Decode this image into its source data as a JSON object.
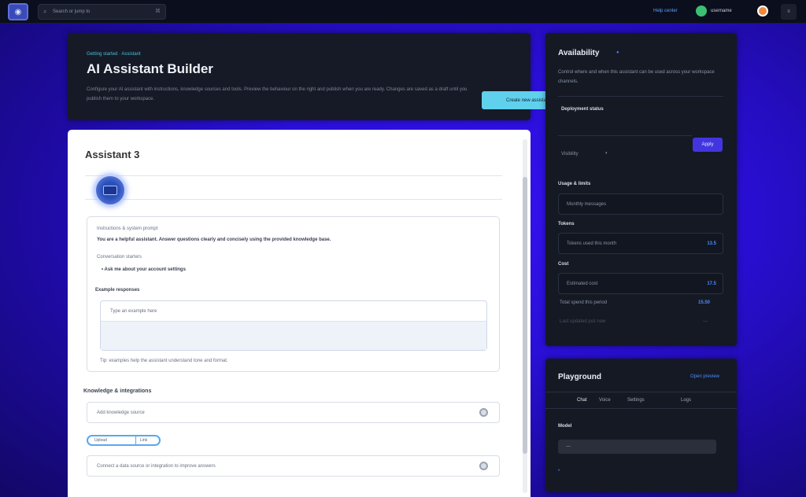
{
  "topbar": {
    "search_placeholder": "Search or jump to",
    "search_shortcut": "⌘",
    "link": "Help center",
    "username": "username",
    "menu": "≡"
  },
  "hero": {
    "eyebrow": "Getting started · Assistant",
    "title": "AI Assistant Builder",
    "description": "Configure your AI assistant with instructions, knowledge sources and tools. Preview the behaviour on the right and publish when you are ready. Changes are saved as a draft until you publish them to your workspace.",
    "cta": "Create new assistant"
  },
  "main": {
    "title": "Assistant 3",
    "card": {
      "section_label": "Instructions & system prompt",
      "line1": "You are a helpful assistant. Answer questions clearly and concisely using the provided knowledge base.",
      "sub_label": "Conversation starters",
      "bullet": "Ask me about your account settings",
      "example_label": "Example responses",
      "box_placeholder": "Type an example here",
      "hint": "Tip: examples help the assistant understand tone and format."
    },
    "section_heading": "Knowledge & integrations",
    "field1": "Add knowledge source",
    "pill_left": "Upload",
    "pill_right": "Link",
    "field2": "Connect a data source or integration to improve answers"
  },
  "panel1": {
    "title": "Availability",
    "badge": "●",
    "desc": "Control where and when this assistant can be used across your workspace channels.",
    "label_status": "Deployment status",
    "label_visibility": "Visibility",
    "toggle_glyph": "◐",
    "apply": "Apply",
    "section_plan": "Usage & limits",
    "row1_label": "Monthly messages",
    "section_a": "Tokens",
    "row2_label": "Tokens used this month",
    "row2_value": "13.5",
    "section_b": "Cost",
    "row3_label": "Estimated cost",
    "row3_value": "17.5",
    "footer_label": "Total spend this period",
    "footer_value": "15.50",
    "faint_label": "Last updated just now",
    "faint_value": "—"
  },
  "panel2": {
    "title": "Playground",
    "link": "Open preview",
    "tabs": [
      "Chat",
      "Voice",
      "Settings",
      "Logs"
    ],
    "section": "Model",
    "input_placeholder": "—",
    "dot": "•"
  }
}
